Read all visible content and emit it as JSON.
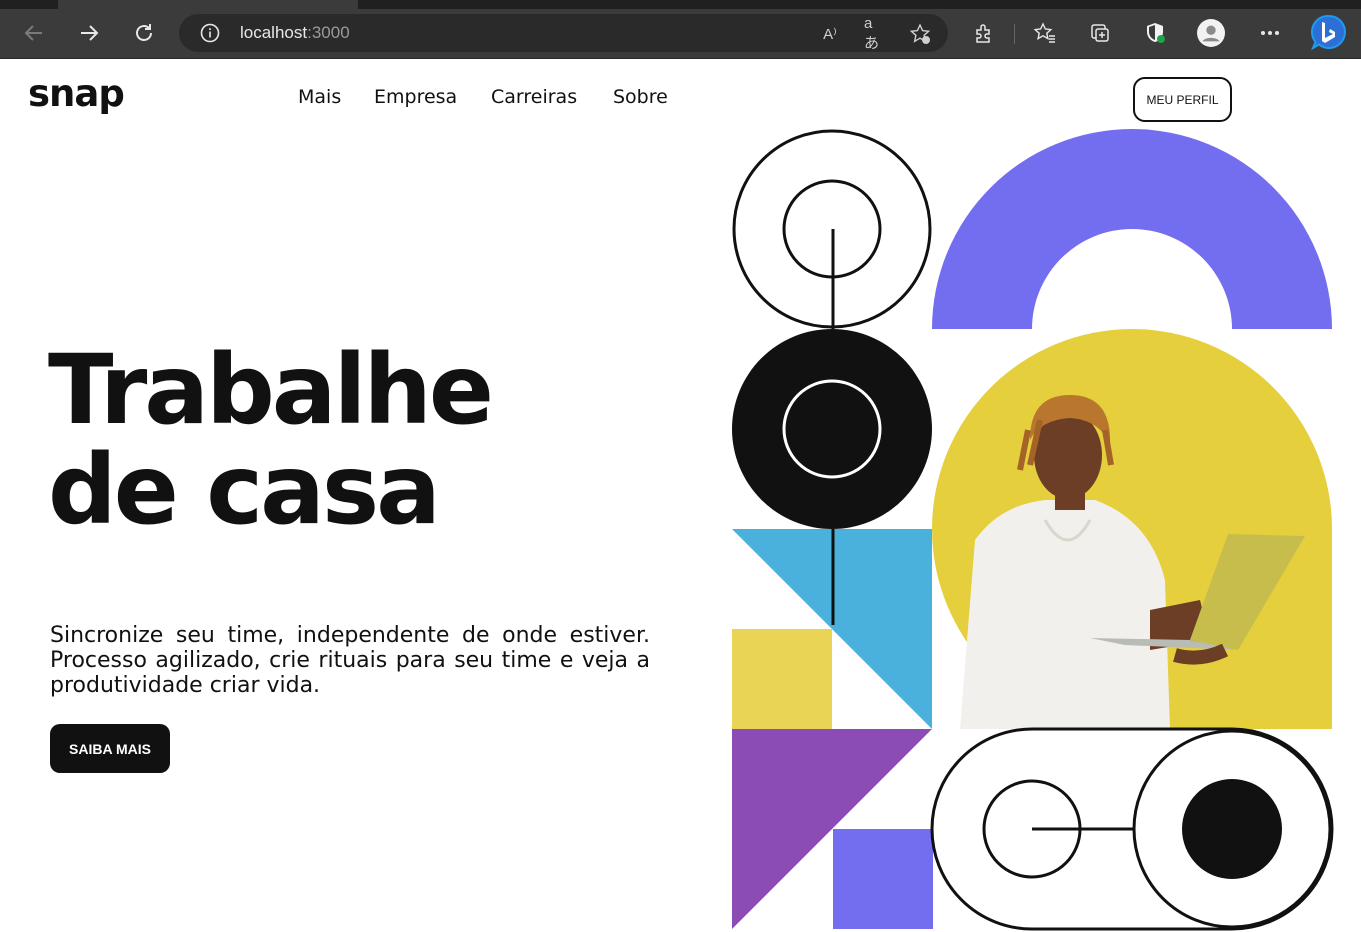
{
  "browser": {
    "url_host": "localhost",
    "url_port": ":3000",
    "read_aloud_icon": "A⁾",
    "translate_icon": "aあ"
  },
  "header": {
    "logo": "snap",
    "menu": [
      "Mais",
      "Empresa",
      "Carreiras",
      "Sobre"
    ],
    "profile_button": "MEU PERFIL"
  },
  "hero": {
    "title_line1": "Trabalhe",
    "title_line2": "de casa",
    "text": "Sincronize seu time, independente de onde estiver. Processo agilizado, crie rituais para seu time e veja a produtividade criar vida.",
    "cta": "SAIBA MAIS"
  },
  "colors": {
    "purple": "#736df0",
    "yellow": "#e9d456",
    "blue": "#4ab0dc",
    "violet": "#8b4cb5",
    "photo_bg": "#e5cf3c",
    "dark": "#111111"
  }
}
